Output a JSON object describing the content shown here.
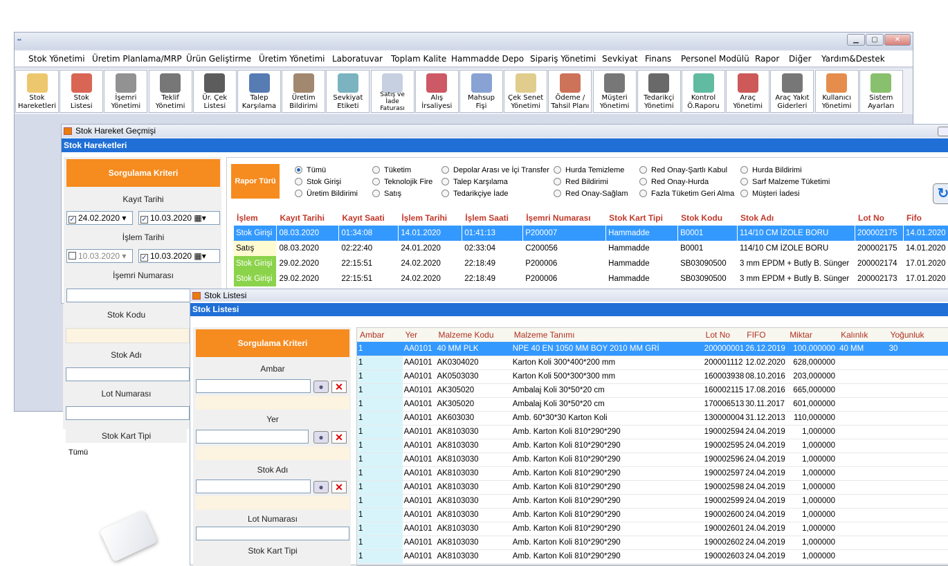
{
  "menu": [
    "Stok Yönetimi",
    "Üretim Planlama/MRP",
    "Ürün Geliştirme",
    "Üretim Yönetimi",
    "Laboratuvar",
    "Toplam Kalite",
    "Hammadde Depo",
    "Sipariş Yönetimi",
    "Sevkiyat",
    "Finans",
    "Personel Modülü",
    "Rapor",
    "Diğer",
    "Yardım&Destek"
  ],
  "toolbar": [
    {
      "l1": "Stok",
      "l2": "Hareketleri",
      "icon": "arrows-icon",
      "c": "#e9b949"
    },
    {
      "l1": "Stok",
      "l2": "Listesi",
      "icon": "boxes-icon",
      "c": "#d0402a"
    },
    {
      "l1": "İşemri",
      "l2": "Yönetimi",
      "icon": "team-icon",
      "c": "#777"
    },
    {
      "l1": "Teklif",
      "l2": "Yönetimi",
      "icon": "handshake-icon",
      "c": "#555"
    },
    {
      "l1": "Ür. Çek",
      "l2": "Listesi",
      "icon": "loop-icon",
      "c": "#333"
    },
    {
      "l1": "Talep",
      "l2": "Karşılama",
      "icon": "updown-icon",
      "c": "#2d5aa0"
    },
    {
      "l1": "Üretim",
      "l2": "Bildirimi",
      "icon": "factory-icon",
      "c": "#8a6a4a"
    },
    {
      "l1": "Sevkiyat",
      "l2": "Etiketi",
      "icon": "truck-label-icon",
      "c": "#5aa0b0"
    },
    {
      "l1": "Satış ve",
      "l2": "İade",
      "l3": "Faturası",
      "icon": "invoice-icon",
      "c": "#b8c4d8"
    },
    {
      "l1": "Alış",
      "l2": "İrsaliyesi",
      "icon": "barcode-icon",
      "c": "#c03040"
    },
    {
      "l1": "Mahsup",
      "l2": "Fişi",
      "icon": "document-icon",
      "c": "#6a8cc8"
    },
    {
      "l1": "Çek Senet",
      "l2": "Yönetimi",
      "icon": "cheque-icon",
      "c": "#d8c070"
    },
    {
      "l1": "Ödeme /",
      "l2": "Tahsil Planı",
      "icon": "calendar-icon",
      "c": "#c05030"
    },
    {
      "l1": "Müşteri",
      "l2": "Yönetimi",
      "icon": "customer-icon",
      "c": "#555"
    },
    {
      "l1": "Tedarikçi",
      "l2": "Yönetimi",
      "icon": "supplier-icon",
      "c": "#444"
    },
    {
      "l1": "Kontrol",
      "l2": "Ö.Raporu",
      "icon": "check-icon",
      "c": "#3aaa8a"
    },
    {
      "l1": "Araç",
      "l2": "Yönetimi",
      "icon": "truck-icon",
      "c": "#c03030"
    },
    {
      "l1": "Araç Yakıt",
      "l2": "Giderleri",
      "icon": "fuel-icon",
      "c": "#555"
    },
    {
      "l1": "Kullanıcı",
      "l2": "Yönetimi",
      "icon": "user-gear-icon",
      "c": "#e07020"
    },
    {
      "l1": "Sistem",
      "l2": "Ayarları",
      "icon": "gear-icon",
      "c": "#6ab04a"
    }
  ],
  "hw": {
    "title": "Stok Hareket Geçmişi",
    "bar": "Stok Hareketleri",
    "criteria": "Sorgulama Kriteri",
    "kayit": "Kayıt Tarihi",
    "d1": "24.02.2020",
    "d2": "10.03.2020",
    "islem": "İşlem Tarihi",
    "d3": "10.03.2020",
    "d4": "10.03.2020",
    "isemri": "İşemri Numarası",
    "stokkodu": "Stok Kodu",
    "stokadi": "Stok Adı",
    "lotnum": "Lot Numarası",
    "karttipi": "Stok Kart Tipi",
    "tumu": "Tümü",
    "rapor": "Rapor Türü",
    "radios": [
      [
        "Tümü",
        "Stok Girişi",
        "Üretim Bildirimi"
      ],
      [
        "Tüketim",
        "Teknolojik Fire",
        "Satış"
      ],
      [
        "Depolar Arası ve İçi Transfer",
        "Talep Karşılama",
        "Tedarikçiye İade"
      ],
      [
        "Hurda Temizleme",
        "Red Bildirimi",
        "Red Onay-Sağlam"
      ],
      [
        "Red Onay-Şartlı Kabul",
        "Red Onay-Hurda",
        "Fazla Tüketim Geri Alma"
      ],
      [
        "Hurda Bildirimi",
        "Sarf Malzeme Tüketimi",
        "Müşteri İadesi"
      ]
    ],
    "cols": [
      "İşlem",
      "Kayıt Tarihi",
      "Kayıt Saati",
      "İşlem Tarihi",
      "İşlem Saati",
      "İşemri Numarası",
      "Stok Kart Tipi",
      "Stok Kodu",
      "Stok Adı",
      "Lot No",
      "Fifo"
    ],
    "rows": [
      [
        "Stok Girişi",
        "08.03.2020",
        "01:34:08",
        "14.01.2020",
        "01:41:13",
        "P200007",
        "Hammadde",
        "B0001",
        "114/10 CM İZOLE BORU",
        "200002175",
        "14.01.2020"
      ],
      [
        "Satış",
        "08.03.2020",
        "02:22:40",
        "24.01.2020",
        "02:33:04",
        "C200056",
        "Hammadde",
        "B0001",
        "114/10 CM İZOLE BORU",
        "200002175",
        "14.01.2020"
      ],
      [
        "Stok Girişi",
        "29.02.2020",
        "22:15:51",
        "24.02.2020",
        "22:18:49",
        "P200006",
        "Hammadde",
        "SB03090500",
        "3 mm EPDM + Butly B. Sünger",
        "200002174",
        "17.01.2020"
      ],
      [
        "Stok Girişi",
        "29.02.2020",
        "22:15:51",
        "24.02.2020",
        "22:18:49",
        "P200006",
        "Hammadde",
        "SB03090500",
        "3 mm EPDM + Butly B. Sünger",
        "200002173",
        "17.01.2020"
      ]
    ]
  },
  "lw": {
    "title": "Stok Listesi",
    "bar": "Stok Listesi",
    "criteria": "Sorgulama Kriteri",
    "ambar": "Ambar",
    "yer": "Yer",
    "stokadi": "Stok Adı",
    "lotnum": "Lot Numarası",
    "karttipi": "Stok Kart Tipi",
    "cols": [
      "Ambar",
      "Yer",
      "Malzeme Kodu",
      "Malzeme Tanımı",
      "Lot No",
      "FIFO",
      "Miktar",
      "Kalınlık",
      "Yoğunluk"
    ],
    "rows": [
      [
        "1",
        "AA0101",
        "40 MM PLK",
        "NPE 40 EN 1050 MM BOY 2010 MM GRİ",
        "200000001",
        "26.12.2019",
        "100,000000",
        "40 MM",
        "30"
      ],
      [
        "1",
        "AA0101",
        "AK0304020",
        "Karton Koli 300*400*200 mm",
        "200001112",
        "12.02.2020",
        "628,000000",
        "",
        ""
      ],
      [
        "1",
        "AA0101",
        "AK0503030",
        "Karton Koli 500*300*300 mm",
        "160003938",
        "08.10.2016",
        "203,000000",
        "",
        ""
      ],
      [
        "1",
        "AA0101",
        "AK305020",
        "Ambalaj Koli 30*50*20 cm",
        "160002115",
        "17.08.2016",
        "665,000000",
        "",
        ""
      ],
      [
        "1",
        "AA0101",
        "AK305020",
        "Ambalaj Koli 30*50*20 cm",
        "170006513",
        "30.11.2017",
        "601,000000",
        "",
        ""
      ],
      [
        "1",
        "AA0101",
        "AK603030",
        "Amb. 60*30*30 Karton Koli",
        "130000004",
        "31.12.2013",
        "110,000000",
        "",
        ""
      ],
      [
        "1",
        "AA0101",
        "AK8103030",
        "Amb. Karton Koli 810*290*290",
        "190002594",
        "24.04.2019",
        "1,000000",
        "",
        ""
      ],
      [
        "1",
        "AA0101",
        "AK8103030",
        "Amb. Karton Koli 810*290*290",
        "190002595",
        "24.04.2019",
        "1,000000",
        "",
        ""
      ],
      [
        "1",
        "AA0101",
        "AK8103030",
        "Amb. Karton Koli 810*290*290",
        "190002596",
        "24.04.2019",
        "1,000000",
        "",
        ""
      ],
      [
        "1",
        "AA0101",
        "AK8103030",
        "Amb. Karton Koli 810*290*290",
        "190002597",
        "24.04.2019",
        "1,000000",
        "",
        ""
      ],
      [
        "1",
        "AA0101",
        "AK8103030",
        "Amb. Karton Koli 810*290*290",
        "190002598",
        "24.04.2019",
        "1,000000",
        "",
        ""
      ],
      [
        "1",
        "AA0101",
        "AK8103030",
        "Amb. Karton Koli 810*290*290",
        "190002599",
        "24.04.2019",
        "1,000000",
        "",
        ""
      ],
      [
        "1",
        "AA0101",
        "AK8103030",
        "Amb. Karton Koli 810*290*290",
        "190002600",
        "24.04.2019",
        "1,000000",
        "",
        ""
      ],
      [
        "1",
        "AA0101",
        "AK8103030",
        "Amb. Karton Koli 810*290*290",
        "190002601",
        "24.04.2019",
        "1,000000",
        "",
        ""
      ],
      [
        "1",
        "AA0101",
        "AK8103030",
        "Amb. Karton Koli 810*290*290",
        "190002602",
        "24.04.2019",
        "1,000000",
        "",
        ""
      ],
      [
        "1",
        "AA0101",
        "AK8103030",
        "Amb. Karton Koli 810*290*290",
        "190002603",
        "24.04.2019",
        "1,000000",
        "",
        ""
      ]
    ]
  }
}
